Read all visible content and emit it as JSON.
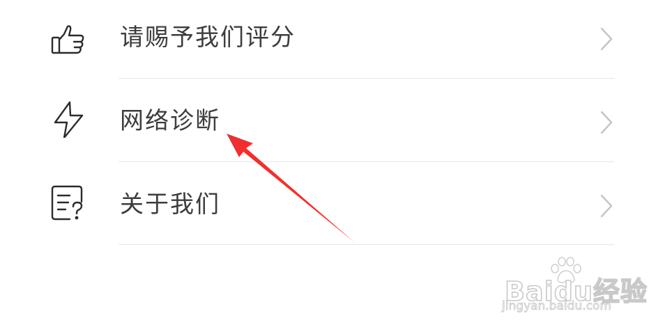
{
  "menu": {
    "items": [
      {
        "label": "请赐予我们评分",
        "icon": "thumbs-up-icon"
      },
      {
        "label": "网络诊断",
        "icon": "lightning-icon"
      },
      {
        "label": "关于我们",
        "icon": "document-question-icon"
      }
    ]
  },
  "annotation": {
    "arrow_color": "#f0302e"
  },
  "watermark": {
    "brand": "Baidu经验",
    "url": "jingyan.baidu.com"
  }
}
